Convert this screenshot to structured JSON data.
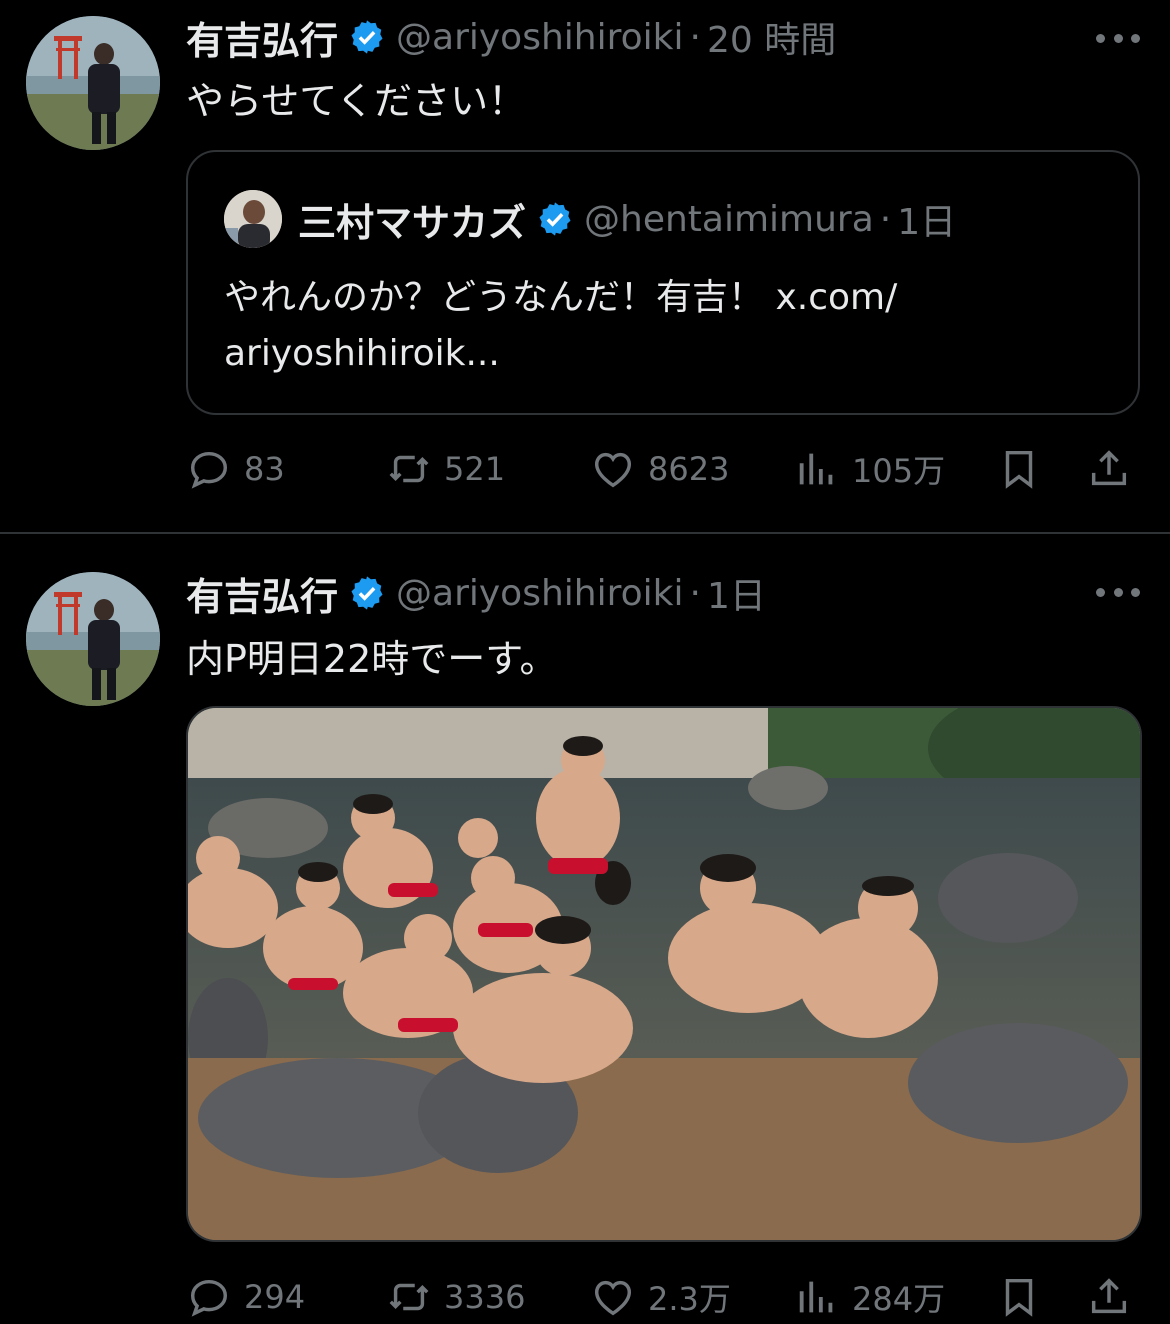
{
  "tweets": [
    {
      "author_name": "有吉弘行",
      "handle": "@ariyoshihiroiki",
      "separator": "·",
      "time": "20 時間",
      "text": "やらせてください！",
      "quote": {
        "author_name": "三村マサカズ",
        "handle": "@hentaimimura",
        "separator": "·",
        "time": "1日",
        "text": "やれんのか？どうなんだ！有吉！ x.com/ ariyoshihiroik..."
      },
      "stats": {
        "replies": "83",
        "retweets": "521",
        "likes": "8623",
        "views": "105万"
      }
    },
    {
      "author_name": "有吉弘行",
      "handle": "@ariyoshihiroiki",
      "separator": "·",
      "time": "1日",
      "text": "内P明日22時でーす。",
      "media": {
        "alt": "photo"
      },
      "stats": {
        "replies": "294",
        "retweets": "3336",
        "likes": "2.3万",
        "views": "284万"
      }
    }
  ],
  "colors": {
    "background": "#000000",
    "text": "#e7e9ea",
    "muted": "#71767b",
    "verified": "#1d9bf0",
    "border": "#2f3336"
  },
  "icons": [
    "verified-badge-icon",
    "more-icon",
    "reply-icon",
    "retweet-icon",
    "like-icon",
    "views-icon",
    "bookmark-icon",
    "share-icon"
  ]
}
